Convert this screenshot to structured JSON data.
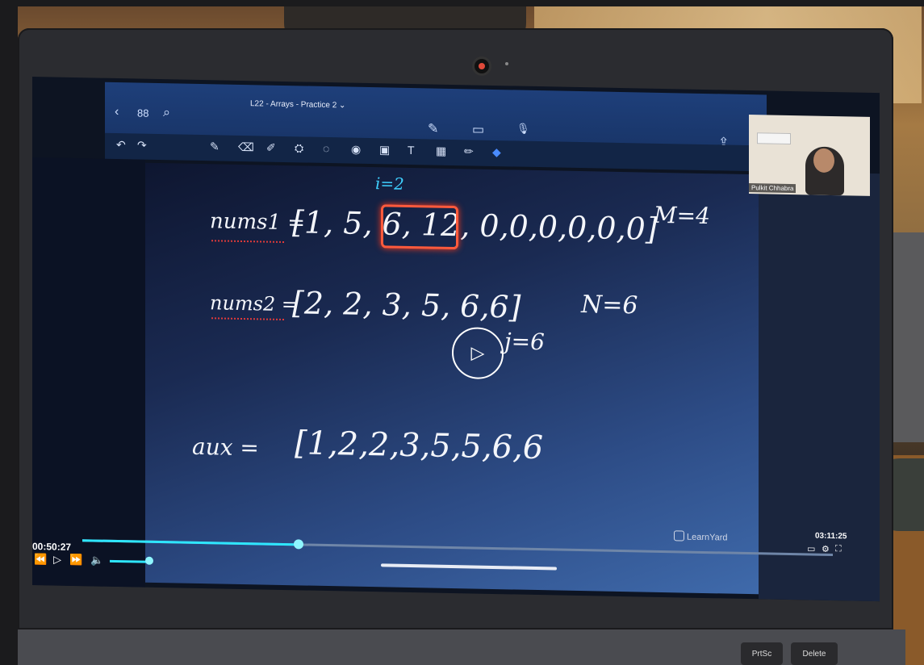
{
  "window": {
    "title": "L22 - Arrays - Practice 2 ⌄"
  },
  "header_icons": {
    "back": "‹",
    "grid": "88",
    "search": "⌕",
    "pen": "✎",
    "board": "▭",
    "mic": "🎙",
    "share": "⇪"
  },
  "toolbar": {
    "undo": "↶",
    "redo": "↷",
    "tools": [
      "✎",
      "⌫",
      "✐",
      "⛭",
      "◌",
      "◉",
      "▣",
      "T",
      "▦",
      "✏",
      "◆"
    ]
  },
  "whiteboard": {
    "i_label": "i=2",
    "nums1_label": "nums1 =",
    "nums1_values": "[1, 5, 6, 12, 0,0,0,0,0,0]",
    "m_label": "M=4",
    "nums2_label": "nums2 =",
    "nums2_values": "[2, 2, 3, 5, 6,6]",
    "j_label": "j=6",
    "n_label": "N=6",
    "aux_label": "aux =",
    "aux_values": "[1,2,2,3,5,5,6,6"
  },
  "webcam": {
    "name": "Pulkit Chhabra"
  },
  "player": {
    "current_time": "00:50:27",
    "total_time": "03:11:25",
    "progress": 0.288,
    "volume": 0.85,
    "brand": "LearnYard",
    "play_icon": "▷",
    "rewind_icon": "⏪",
    "forward_icon": "⏩",
    "volume_icon": "🔈"
  },
  "keyboard": {
    "delete": "Delete",
    "prtsc": "PrtSc"
  }
}
